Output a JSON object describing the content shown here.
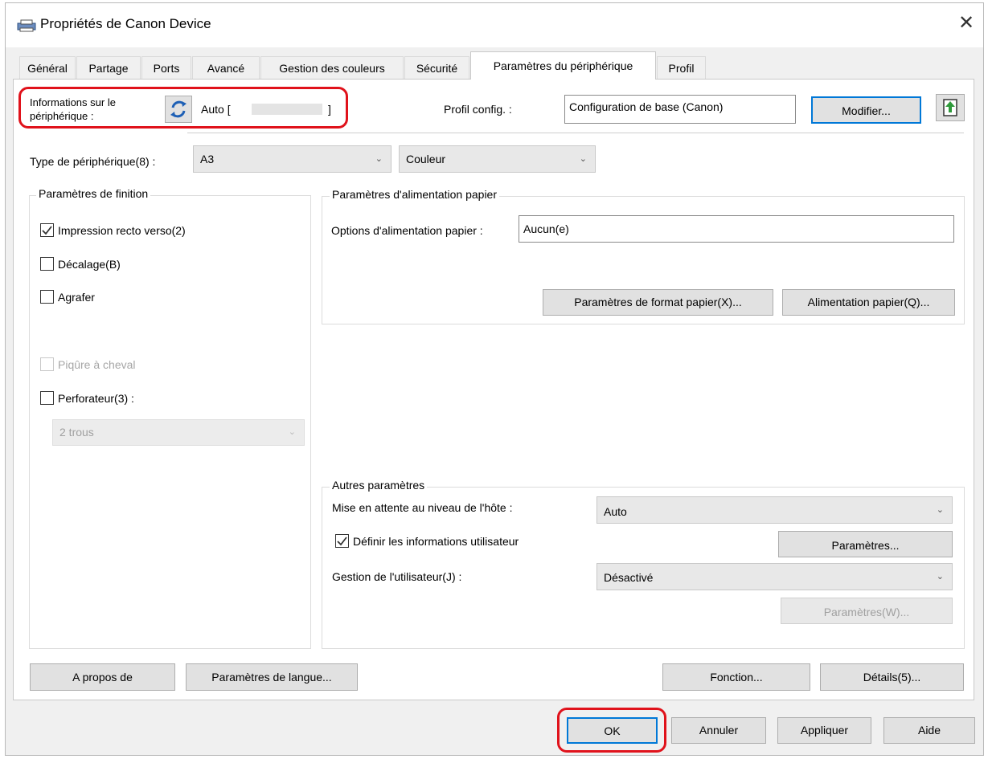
{
  "window": {
    "title": "Propriétés de Canon Device",
    "close_symbol": "✕"
  },
  "tabs": [
    "Général",
    "Partage",
    "Ports",
    "Avancé",
    "Gestion des couleurs",
    "Sécurité",
    "Paramètres du périphérique",
    "Profil"
  ],
  "active_tab": "Paramètres du périphérique",
  "device_info": {
    "label": "Informations sur le périphérique :",
    "status": "Auto [",
    "status_end": "]"
  },
  "profile": {
    "label": "Profil config. :",
    "value": "Configuration de base (Canon)",
    "modify_button": "Modifier..."
  },
  "device_type": {
    "label": "Type de périphérique(8) :",
    "size_value": "A3",
    "color_value": "Couleur"
  },
  "finishing": {
    "title": "Paramètres de finition",
    "duplex": {
      "label": "Impression recto verso(2)",
      "checked": true
    },
    "offset": {
      "label": "Décalage(B)",
      "checked": false
    },
    "staple": {
      "label": "Agrafer",
      "checked": false
    },
    "saddle": {
      "label": "Piqûre à cheval",
      "checked": false,
      "enabled": false
    },
    "punch": {
      "label": "Perforateur(3) :",
      "checked": false
    },
    "punch_select": "2 trous"
  },
  "paper_feed": {
    "title": "Paramètres d'alimentation papier",
    "options_label": "Options d'alimentation papier :",
    "options_value": "Aucun(e)",
    "format_button": "Paramètres de format papier(X)...",
    "feed_button": "Alimentation papier(Q)..."
  },
  "other": {
    "title": "Autres paramètres",
    "spool_label": "Mise en attente au niveau de l'hôte :",
    "spool_value": "Auto",
    "user_info": {
      "label": "Définir les informations utilisateur",
      "checked": true
    },
    "settings_button": "Paramètres...",
    "user_mgmt_label": "Gestion de l'utilisateur(J) :",
    "user_mgmt_value": "Désactivé",
    "settings_w_button": "Paramètres(W)..."
  },
  "bottom_buttons": {
    "about": "A propos de",
    "language": "Paramètres de langue...",
    "function": "Fonction...",
    "details": "Détails(5)..."
  },
  "dialog_buttons": {
    "ok": "OK",
    "cancel": "Annuler",
    "apply": "Appliquer",
    "help": "Aide"
  },
  "colors": {
    "highlight": "#e0121b",
    "checkmark": "#333333"
  }
}
